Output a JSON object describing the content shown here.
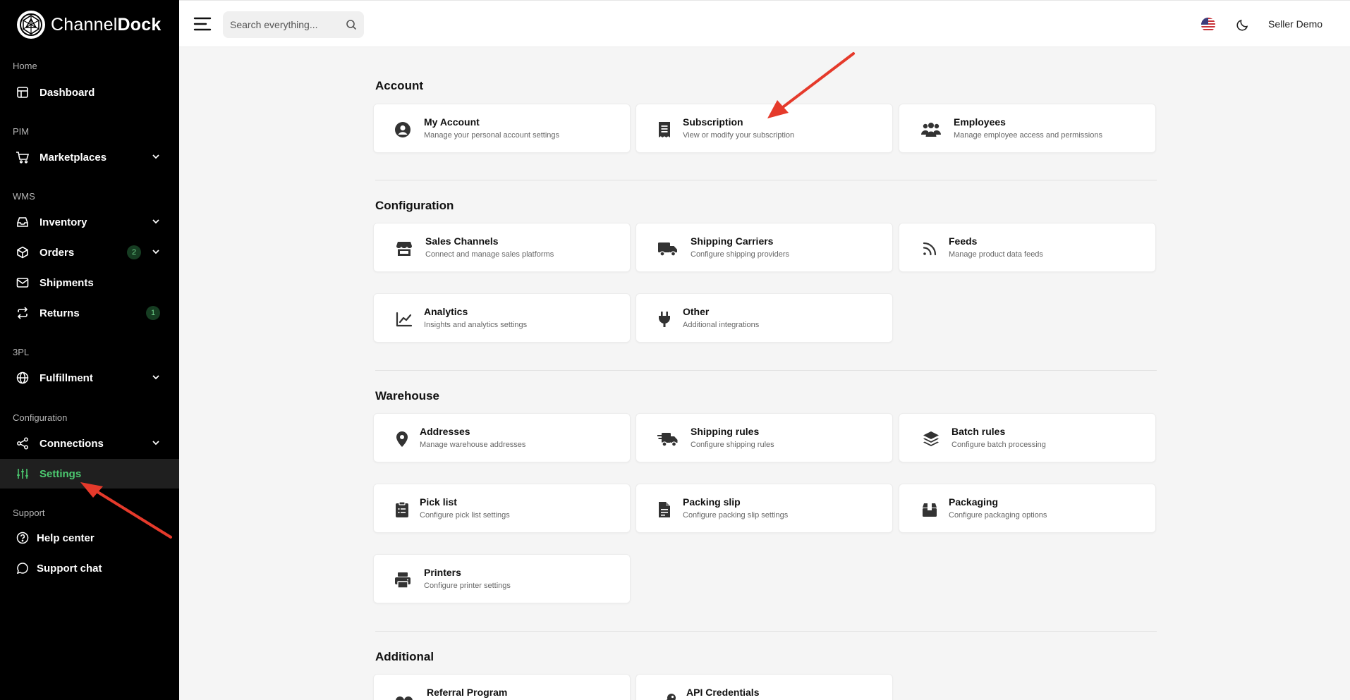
{
  "brand": {
    "name_light": "Channel",
    "name_bold": "Dock"
  },
  "search": {
    "placeholder": "Search everything..."
  },
  "user": {
    "name": "Seller Demo"
  },
  "sidebar": {
    "sections": [
      {
        "label": "Home"
      },
      {
        "label": "PIM"
      },
      {
        "label": "WMS"
      },
      {
        "label": "3PL"
      },
      {
        "label": "Configuration"
      },
      {
        "label": "Support"
      }
    ],
    "items": [
      {
        "label": "Dashboard"
      },
      {
        "label": "Marketplaces"
      },
      {
        "label": "Inventory"
      },
      {
        "label": "Orders",
        "badge": "2"
      },
      {
        "label": "Shipments"
      },
      {
        "label": "Returns",
        "badge": "1"
      },
      {
        "label": "Fulfillment"
      },
      {
        "label": "Connections"
      },
      {
        "label": "Settings"
      },
      {
        "label": "Help center"
      },
      {
        "label": "Support chat"
      }
    ]
  },
  "groups": {
    "account": {
      "title": "Account",
      "cards": [
        {
          "title": "My Account",
          "desc": "Manage your personal account settings",
          "icon": "user-circle-icon"
        },
        {
          "title": "Subscription",
          "desc": "View or modify your subscription",
          "icon": "receipt-icon"
        },
        {
          "title": "Employees",
          "desc": "Manage employee access and permissions",
          "icon": "users-icon"
        }
      ]
    },
    "configuration": {
      "title": "Configuration",
      "cards": [
        {
          "title": "Sales Channels",
          "desc": "Connect and manage sales platforms",
          "icon": "store-icon"
        },
        {
          "title": "Shipping Carriers",
          "desc": "Configure shipping providers",
          "icon": "truck-icon"
        },
        {
          "title": "Feeds",
          "desc": "Manage product data feeds",
          "icon": "rss-icon"
        },
        {
          "title": "Analytics",
          "desc": "Insights and analytics settings",
          "icon": "chart-line-icon"
        },
        {
          "title": "Other",
          "desc": "Additional integrations",
          "icon": "plug-icon"
        }
      ]
    },
    "warehouse": {
      "title": "Warehouse",
      "cards": [
        {
          "title": "Addresses",
          "desc": "Manage warehouse addresses",
          "icon": "map-pin-icon"
        },
        {
          "title": "Shipping rules",
          "desc": "Configure shipping rules",
          "icon": "truck-fast-icon"
        },
        {
          "title": "Batch rules",
          "desc": "Configure batch processing",
          "icon": "layers-icon"
        },
        {
          "title": "Pick list",
          "desc": "Configure pick list settings",
          "icon": "clipboard-list-icon"
        },
        {
          "title": "Packing slip",
          "desc": "Configure packing slip settings",
          "icon": "file-text-icon"
        },
        {
          "title": "Packaging",
          "desc": "Configure packaging options",
          "icon": "box-icon"
        },
        {
          "title": "Printers",
          "desc": "Configure printer settings",
          "icon": "printer-icon"
        }
      ]
    },
    "additional": {
      "title": "Additional",
      "cards": [
        {
          "title": "Referral Program",
          "desc": "",
          "icon": "referral-icon"
        },
        {
          "title": "API Credentials",
          "desc": "",
          "icon": "key-icon"
        }
      ]
    }
  },
  "colors": {
    "sidebar_bg": "#000000",
    "active_green": "#4cc970",
    "annotation_red": "#e53a2b"
  }
}
